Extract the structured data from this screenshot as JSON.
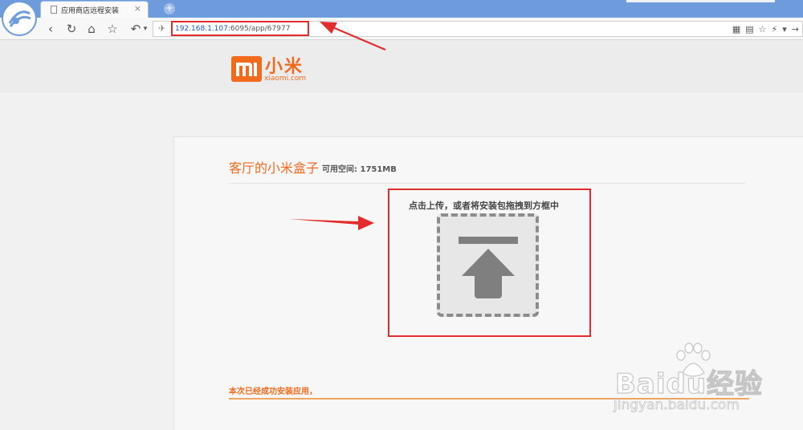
{
  "browser": {
    "tab_title": "应用商店远程安装",
    "tab_close": "×",
    "new_tab": "+",
    "url_host": "192.168.1.107",
    "url_path": ":6095/app/67977",
    "nav": {
      "back": "‹",
      "reload": "↻",
      "home": "⌂",
      "favorite": "☆",
      "undo": "↶",
      "undo_menu": "▾",
      "site": "✈"
    },
    "tools": [
      "▦",
      "▤",
      "☆",
      "⚡",
      "▾",
      "→"
    ]
  },
  "site": {
    "logo_cn": "小米",
    "logo_en": "xiaomi.com",
    "logo_mark": "mi"
  },
  "card": {
    "title": "客厅的小米盒子",
    "space_label": "可用空间: 1751MB",
    "upload_hint": "点击上传，或者将安装包拖拽到方框中",
    "success_text": "本次已经成功安装应用，"
  },
  "watermark": {
    "text": "Baidu经验",
    "sub": "jingyan.baidu.com"
  },
  "colors": {
    "brand": "#f26b1d",
    "annotation": "#e52c2c",
    "titlebar": "#6d9bdc"
  }
}
